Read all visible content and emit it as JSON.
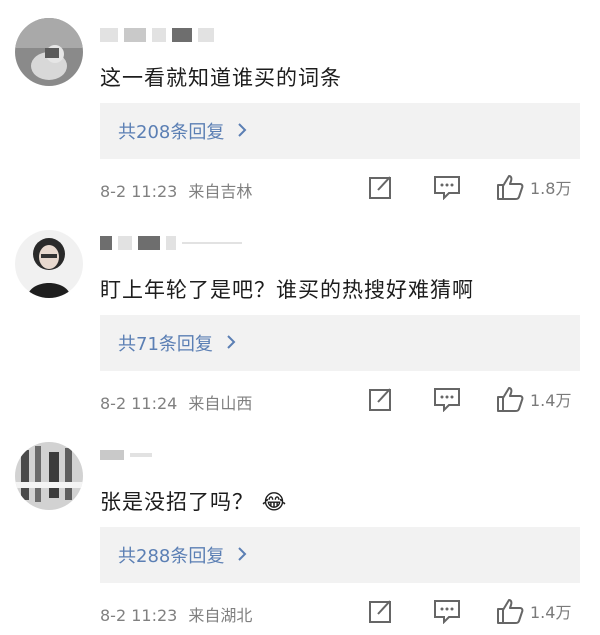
{
  "comments": [
    {
      "text": "这一看就知道谁买的词条",
      "replies_label": "共208条回复",
      "date": "8-2 11:23",
      "location": "来自吉林",
      "likes": "1.8万"
    },
    {
      "text": "盯上年轮了是吧？谁买的热搜好难猜啊",
      "replies_label": "共71条回复",
      "date": "8-2 11:24",
      "location": "来自山西",
      "likes": "1.4万"
    },
    {
      "text": "张是没招了吗？",
      "emoji": "😂",
      "replies_label": "共288条回复",
      "date": "8-2 11:23",
      "location": "来自湖北",
      "likes": "1.4万"
    }
  ],
  "icons": {
    "edit": "edit-icon",
    "message": "message-icon",
    "like": "thumbs-up-icon",
    "chevron": "chevron-right-icon"
  },
  "colors": {
    "link": "#5b7fb4",
    "meta": "#808080",
    "reply_bg": "#f2f2f2"
  }
}
